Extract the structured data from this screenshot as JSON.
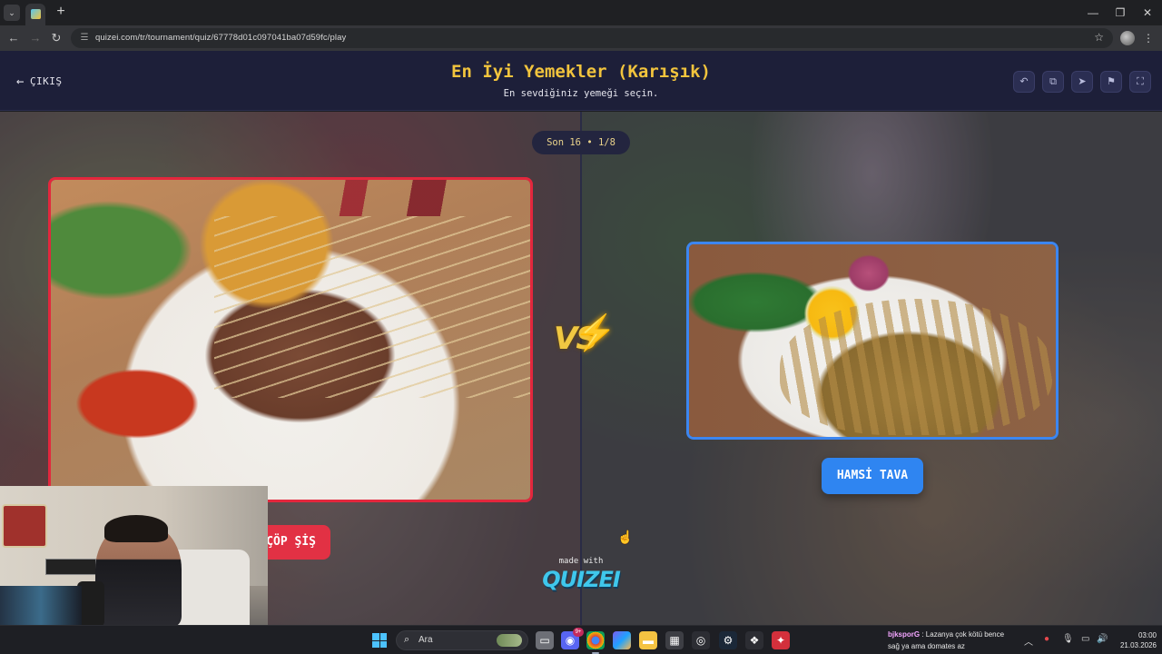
{
  "browser": {
    "tab_title": "",
    "url": "quizei.com/tr/tournament/quiz/67778d01c097041ba07d59fc/play",
    "new_tab_label": "+",
    "window_controls": [
      "—",
      "❐",
      "✕"
    ]
  },
  "header": {
    "exit_label": "ÇIKIŞ",
    "title": "En İyi Yemekler (Karışık)",
    "subtitle": "En sevdiğiniz yemeği seçin.",
    "toolbar_icons": [
      "undo-icon",
      "copy-icon",
      "share-icon",
      "flag-icon",
      "fullscreen-icon"
    ]
  },
  "match": {
    "round_label": "Son 16 • 1/8",
    "left_name": "ÇÖP ŞİŞ",
    "left_visible_name": "ÇÖP ŞİŞ",
    "right_name": "HAMSİ TAVA",
    "vs_label": "VS",
    "left_accent": "#e3273d",
    "right_accent": "#3c86f0"
  },
  "branding": {
    "made_with": "made with",
    "logo": "QUIZEI"
  },
  "taskbar": {
    "search_label": "Ara",
    "discord_badge": "9+",
    "chat_user": "bjksporG",
    "chat_line1": "Lazanya çok kötü bence",
    "chat_line2": "sağ ya ama domates az",
    "time": "03:00",
    "date": "21.03.2026"
  }
}
